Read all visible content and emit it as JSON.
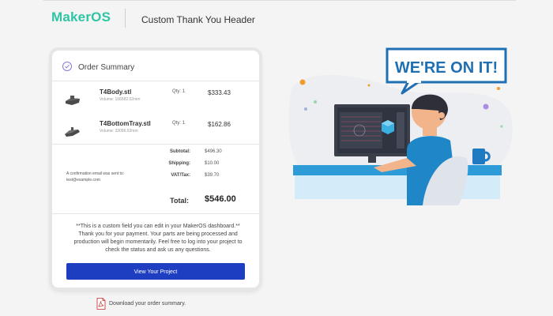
{
  "header": {
    "logo_maker": "Maker",
    "logo_os": "OS",
    "title": "Custom Thank You Header"
  },
  "order": {
    "title": "Order Summary",
    "items": [
      {
        "name": "T4Body.stl",
        "volume": "Volume: 166582.02mm",
        "qty": "Qty: 1",
        "price": "$333.43"
      },
      {
        "name": "T4BottomTray.stl",
        "volume": "Volume: 33096.52mm",
        "qty": "Qty: 1",
        "price": "$162.86"
      }
    ],
    "subtotal_label": "Subtotal:",
    "subtotal_value": "$496.30",
    "shipping_label": "Shipping:",
    "shipping_value": "$10.00",
    "vat_label": "VAT/Tax:",
    "vat_value": "$39.70",
    "confirm_line1": "A confirmation email was sent to:",
    "confirm_email": "test@example.com",
    "total_label": "Total:",
    "total_value": "$546.00",
    "custom_message": "**This is a custom field you can edit in your MakerOS dashboard.** Thank you for your payment. Your parts are being processed and production will begin momentarily. Feel free to log into your project to check the status and ask us any questions.",
    "button_label": "View Your Project"
  },
  "download": {
    "label": "Download your order summary.",
    "icon": "pdf-icon"
  },
  "illustration": {
    "speech_text": "WE'RE ON IT!"
  },
  "colors": {
    "brand": "#2ec4a4",
    "button": "#1e3ec1",
    "speech": "#1f6fb3"
  }
}
